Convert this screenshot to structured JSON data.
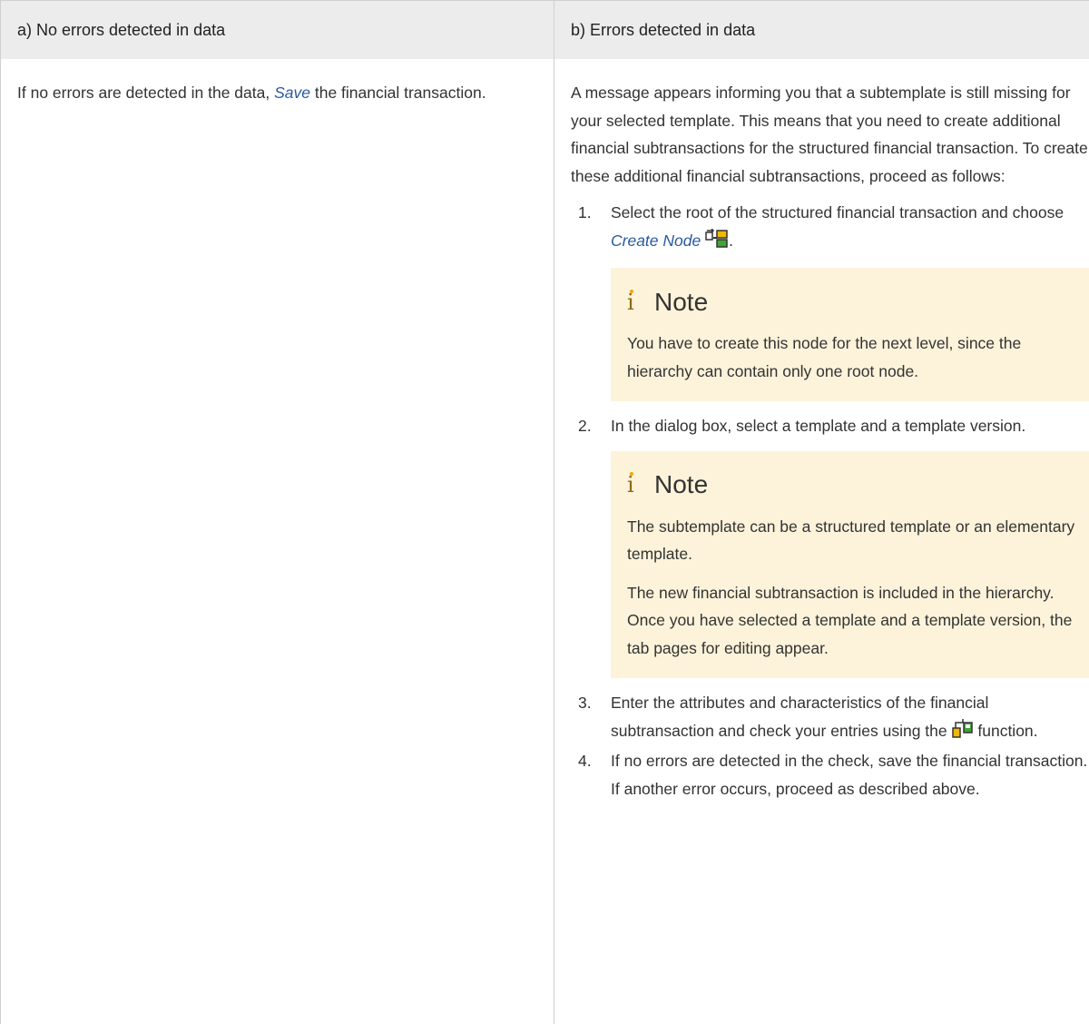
{
  "header": {
    "col_a": "a) No errors detected in data",
    "col_b": "b) Errors detected in data"
  },
  "col_a": {
    "text_before": "If no errors are detected in the data, ",
    "link": "Save",
    "text_after": " the financial transaction."
  },
  "col_b": {
    "intro": "A message appears informing you that a subtemplate is still missing for your selected template. This means that you need to create additional financial subtransactions for the structured financial transaction. To create these additional financial subtransactions, proceed as follows:",
    "steps": [
      {
        "num": "1.",
        "text_before": "Select the root of the structured financial transaction and choose ",
        "link": "Create Node",
        "text_after": ".",
        "icon": "create-node-icon",
        "note": {
          "icon": "i",
          "title": "Note",
          "paragraphs": [
            "You have to create this node for the next level, since the hierarchy can contain only one root node."
          ]
        }
      },
      {
        "num": "2.",
        "text": "In the dialog box, select a template and a template ver­sion.",
        "note": {
          "icon": "i",
          "title": "Note",
          "paragraphs": [
            "The subtemplate can be a structured template or an elementary template.",
            "The new financial subtransaction is included in the hierarchy. Once you have selected a template and a template version, the tab pages for editing appear."
          ]
        }
      },
      {
        "num": "3.",
        "text_before": "Enter the attributes and characteristics of the financial subtransaction and check your entries using the ",
        "text_after": " function.",
        "icon": "check-function-icon"
      },
      {
        "num": "4.",
        "text": "If no errors are detected in the check, save the financial transaction. If another error occurs, proceed as descri­bed above."
      }
    ]
  },
  "colors": {
    "header_bg": "#ececec",
    "note_bg": "#fdf3da",
    "link": "#2a5a9e",
    "note_icon": "#f0a800"
  }
}
